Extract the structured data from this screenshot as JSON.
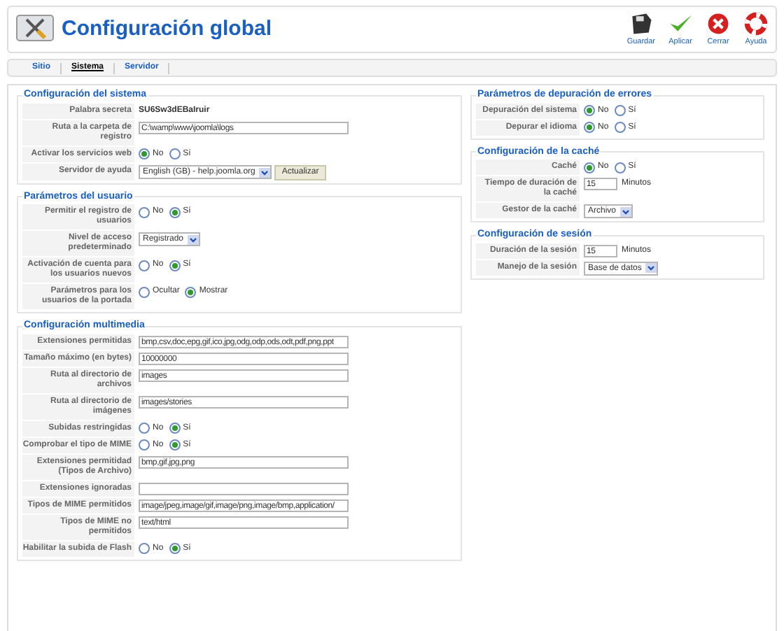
{
  "header": {
    "title": "Configuración global",
    "toolbar": [
      {
        "label": "Guardar"
      },
      {
        "label": "Aplicar"
      },
      {
        "label": "Cerrar"
      },
      {
        "label": "Ayuda"
      }
    ]
  },
  "tabs": [
    {
      "label": "Sitio",
      "selected": false
    },
    {
      "label": "Sistema",
      "selected": true
    },
    {
      "label": "Servidor",
      "selected": false
    }
  ],
  "left_sections": [
    {
      "title": "Configuración del sistema",
      "rows": [
        {
          "kind": "static",
          "label": "Palabra secreta",
          "value": "SU6Sw3dEBaIruir"
        },
        {
          "kind": "input",
          "label": "Ruta a la carpeta de registro",
          "value": "C:\\wamp\\www\\joomla\\logs"
        },
        {
          "kind": "radio",
          "label": "Activar los servicios web",
          "options": [
            {
              "label": "No",
              "selected": true
            },
            {
              "label": "Sí",
              "selected": false
            }
          ]
        },
        {
          "kind": "select",
          "label": "Servidor de ayuda",
          "value": "English (GB) - help.joomla.org",
          "button": "Actualizar"
        }
      ]
    },
    {
      "title": "Parámetros del usuario",
      "rows": [
        {
          "kind": "radio",
          "label": "Permitir el registro de usuarios",
          "options": [
            {
              "label": "No",
              "selected": false
            },
            {
              "label": "Sí",
              "selected": true
            }
          ]
        },
        {
          "kind": "select",
          "label": "Nivel de acceso predeterminado",
          "value": "Registrado"
        },
        {
          "kind": "radio",
          "label": "Activación de cuenta para los usuarios nuevos",
          "options": [
            {
              "label": "No",
              "selected": false
            },
            {
              "label": "Sí",
              "selected": true
            }
          ]
        },
        {
          "kind": "radio",
          "label": "Parámetros para los usuarios de la portada",
          "options": [
            {
              "label": "Ocultar",
              "selected": false
            },
            {
              "label": "Mostrar",
              "selected": true
            }
          ]
        }
      ]
    },
    {
      "title": "Configuración multimedia",
      "rows": [
        {
          "kind": "input",
          "label": "Extensiones permitidas",
          "value": "bmp,csv,doc,epg,gif,ico,jpg,odg,odp,ods,odt,pdf,png,ppt"
        },
        {
          "kind": "input",
          "label": "Tamaño máximo (en bytes)",
          "value": "10000000"
        },
        {
          "kind": "input",
          "label": "Ruta al directorio de archivos",
          "value": "images"
        },
        {
          "kind": "input",
          "label": "Ruta al directorio de imágenes",
          "value": "images/stories"
        },
        {
          "kind": "radio",
          "label": "Subidas restringidas",
          "options": [
            {
              "label": "No",
              "selected": false
            },
            {
              "label": "Sí",
              "selected": true
            }
          ]
        },
        {
          "kind": "radio",
          "label": "Comprobar el tipo de MIME",
          "options": [
            {
              "label": "No",
              "selected": false
            },
            {
              "label": "Sí",
              "selected": true
            }
          ]
        },
        {
          "kind": "input",
          "label": "Extensiones permitidad (Tipos de Archivo)",
          "value": "bmp,gif,jpg,png"
        },
        {
          "kind": "input",
          "label": "Extensiones ignoradas"
        },
        {
          "kind": "input",
          "label": "Tipos de MIME permitidos",
          "value": "image/jpeg,image/gif,image/png,image/bmp,application/"
        },
        {
          "kind": "input",
          "label": "Tipos de MIME no permitidos",
          "value": "text/html"
        },
        {
          "kind": "radio",
          "label": "Habilitar la subida de Flash",
          "options": [
            {
              "label": "No",
              "selected": false
            },
            {
              "label": "Sí",
              "selected": true
            }
          ]
        }
      ]
    }
  ],
  "right_sections": [
    {
      "title": "Parámetros de depuración de errores",
      "rows": [
        {
          "kind": "radio",
          "label": "Depuración del sistema",
          "options": [
            {
              "label": "No",
              "selected": true
            },
            {
              "label": "Sí",
              "selected": false
            }
          ]
        },
        {
          "kind": "radio",
          "label": "Depurar el idioma",
          "options": [
            {
              "label": "No",
              "selected": true
            },
            {
              "label": "Sí",
              "selected": false
            }
          ]
        }
      ]
    },
    {
      "title": "Configuración de la caché",
      "rows": [
        {
          "kind": "radio",
          "label": "Caché",
          "options": [
            {
              "label": "No",
              "selected": true
            },
            {
              "label": "Sí",
              "selected": false
            }
          ]
        },
        {
          "kind": "input",
          "label": "Tiempo de duración de la caché",
          "value": "15",
          "unit": "Minutos"
        },
        {
          "kind": "select",
          "label": "Gestor de la caché",
          "value": "Archivo"
        }
      ]
    },
    {
      "title": "Configuración de sesión",
      "rows": [
        {
          "kind": "input",
          "label": "Duración de la sesión",
          "value": "15",
          "unit": "Minutos"
        },
        {
          "kind": "select",
          "label": "Manejo de la sesión",
          "value": "Base de datos"
        }
      ]
    }
  ]
}
